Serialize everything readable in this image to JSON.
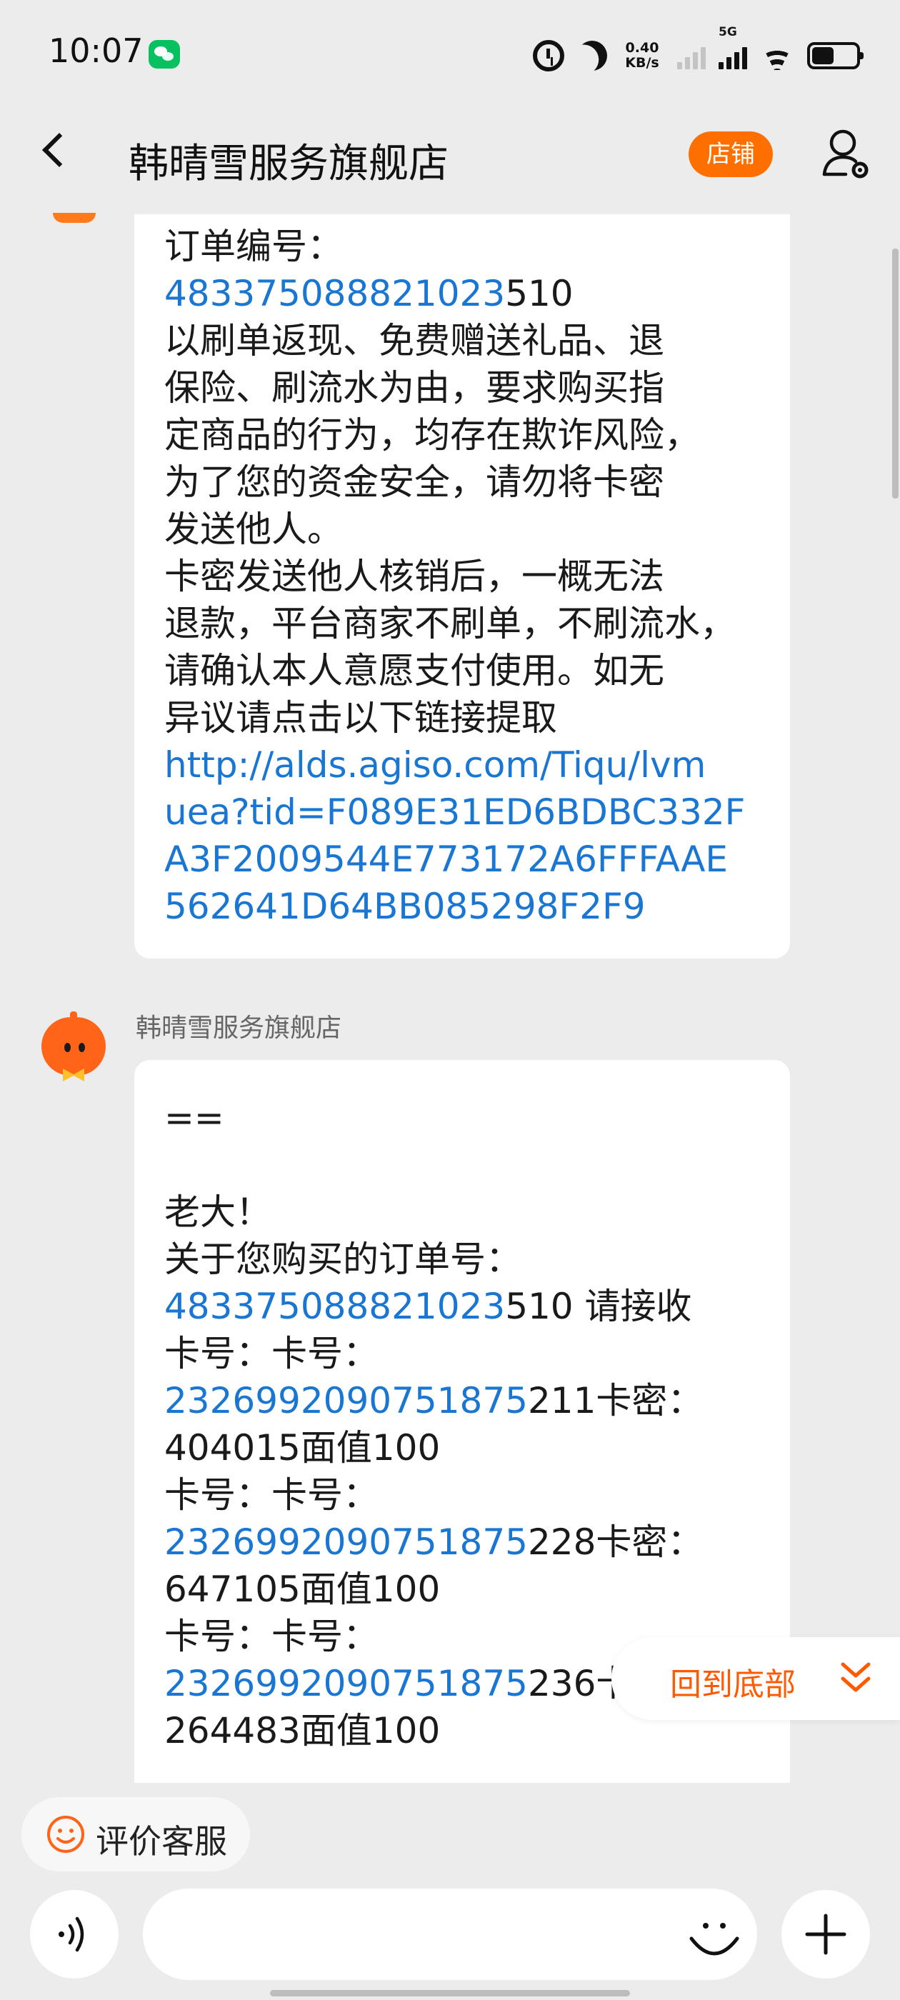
{
  "status_bar": {
    "time": "10:07",
    "net_speed_value": "0.40",
    "net_speed_unit": "KB/s",
    "signal_label": "5G",
    "icons": [
      "wechat-icon",
      "alarm-icon",
      "moon-icon",
      "signal-icon",
      "wifi-icon",
      "battery-icon"
    ]
  },
  "header": {
    "title": "韩晴雪服务旗舰店",
    "shop_button": "店铺"
  },
  "messages": [
    {
      "lines": [
        "订单编号：",
        {
          "link": "483375088821023",
          "after": "510"
        },
        "以刷单返现、免费赠送礼品、退",
        "保险、刷流水为由，要求购买指",
        "定商品的行为，均存在欺诈风险，",
        "为了您的资金安全，请勿将卡密",
        "发送他人。",
        "卡密发送他人核销后，一概无法",
        "退款，平台商家不刷单，不刷流水，",
        "请确认本人意愿支付使用。如无",
        "异议请点击以下链接提取",
        {
          "link": "http://alds.agiso.com/Tiqu/lvm"
        },
        {
          "link": "uea?tid=F089E31ED6BDBC332F"
        },
        {
          "link": "A3F2009544E773172A6FFFAAE"
        },
        {
          "link": "562641D64BB085298F2F9"
        }
      ]
    },
    {
      "sender": "韩晴雪服务旗舰店",
      "lines": [
        "==",
        "",
        "老大！",
        "关于您购买的订单号：",
        {
          "link": "483375088821023",
          "after": "510 请接收"
        },
        "卡号：卡号：",
        {
          "link": "2326992090751875",
          "after": "211卡密："
        },
        "404015面值100",
        "卡号：卡号：",
        {
          "link": "2326992090751875",
          "after": "228卡密："
        },
        "647105面值100",
        "卡号：卡号：",
        {
          "link": "2326992090751875",
          "after": "236卡密："
        },
        "264483面值100"
      ]
    }
  ],
  "back_to_bottom": "回到底部",
  "rate_service": "评价客服",
  "input": {
    "placeholder": ""
  },
  "colors": {
    "accent": "#ff6f00",
    "link": "#1976d2",
    "background": "#ececec"
  }
}
